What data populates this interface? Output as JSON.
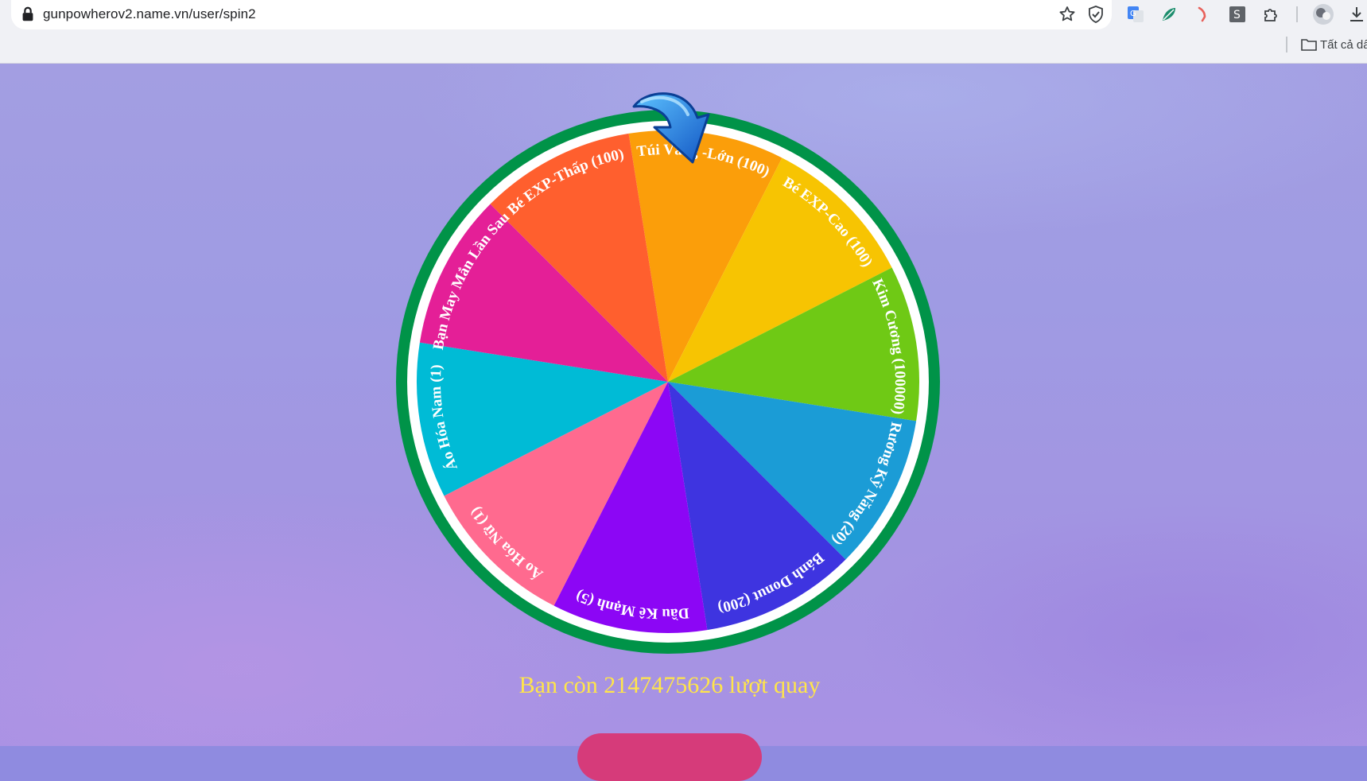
{
  "browser": {
    "url": "gunpowherov2.name.vn/user/spin2",
    "bookmarks_label": "Tất cả dấ"
  },
  "wheel": {
    "segments": [
      {
        "label": "Túi Vàng -Lớn (100)",
        "color": "#fb9e0a"
      },
      {
        "label": "Bé EXP-Cao (100)",
        "color": "#f7c402"
      },
      {
        "label": "Kim Cương (100000)",
        "color": "#6fc915"
      },
      {
        "label": "Rương Kỹ Năng (20)",
        "color": "#1b9cd6"
      },
      {
        "label": "Bánh Donut (200)",
        "color": "#3e34e0"
      },
      {
        "label": "Dầu Kê Mạnh (5)",
        "color": "#8c06f5"
      },
      {
        "label": "Áo Hóa Nữ (1)",
        "color": "#ff6a8f"
      },
      {
        "label": "Áo Hóa Nam (1)",
        "color": "#00bbd6"
      },
      {
        "label": "Bạn May Mắn Lần Sau",
        "color": "#e41f97"
      },
      {
        "label": "Bé EXP-Thấp (100)",
        "color": "#ff5f2e"
      }
    ],
    "rim_color": "#009348",
    "pointer_icon": "blue-arrow-pointer"
  },
  "status": {
    "spins_text": "Bạn còn 2147475626 lượt quay"
  },
  "colors": {
    "spins_text": "#ffe54a",
    "spin_button": "#d63b7a"
  }
}
